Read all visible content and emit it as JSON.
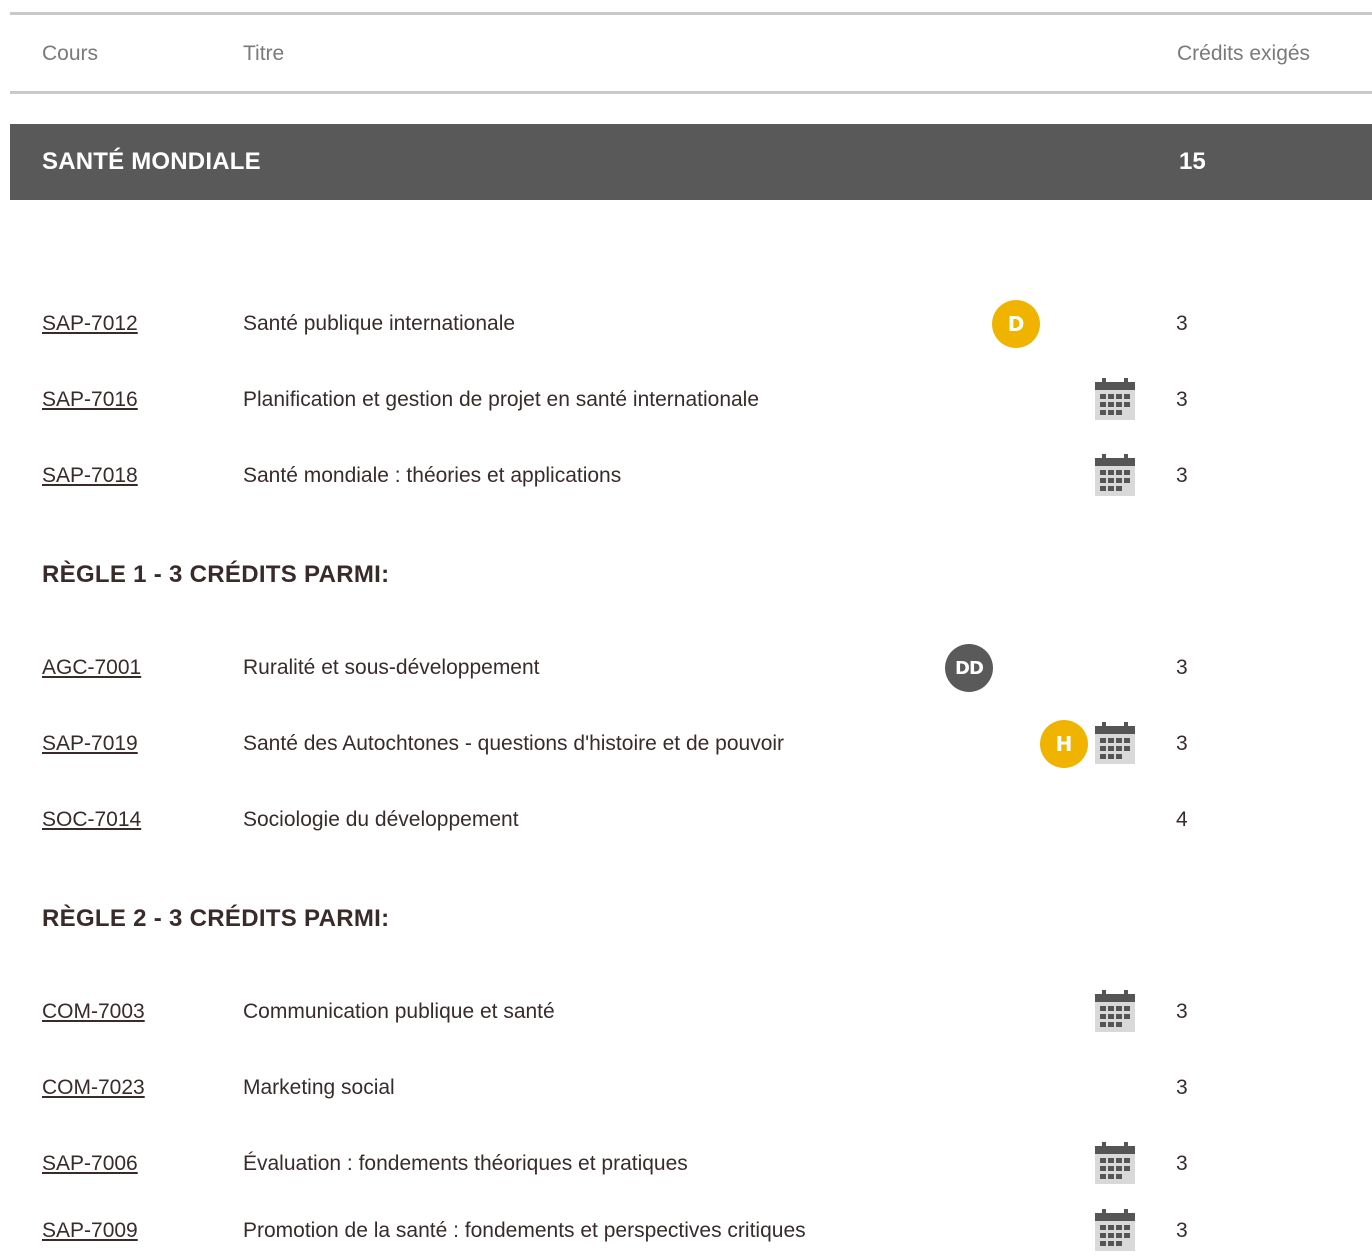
{
  "header": {
    "col_course": "Cours",
    "col_title": "Titre",
    "col_credits": "Crédits exigés"
  },
  "section": {
    "title": "SANTÉ MONDIALE",
    "credits": "15"
  },
  "colors": {
    "section_bar": "#595959",
    "badge_yellow": "#f0b400",
    "badge_grey": "#5a5a5a",
    "text": "#3a2b2b"
  },
  "required_courses": [
    {
      "code": "SAP-7012",
      "title": "Santé publique internationale",
      "credits": "3",
      "badge": "D",
      "calendar": false
    },
    {
      "code": "SAP-7016",
      "title": "Planification et gestion de projet en santé internationale",
      "credits": "3",
      "badge": null,
      "calendar": true
    },
    {
      "code": "SAP-7018",
      "title": "Santé mondiale : théories et applications",
      "credits": "3",
      "badge": null,
      "calendar": true
    }
  ],
  "rule1": {
    "title": "RÈGLE 1 - 3 CRÉDITS PARMI:",
    "courses": [
      {
        "code": "AGC-7001",
        "title": "Ruralité et sous-développement",
        "credits": "3",
        "badge": "DD",
        "calendar": false
      },
      {
        "code": "SAP-7019",
        "title": "Santé des Autochtones - questions d'histoire et de pouvoir",
        "credits": "3",
        "badge": "H",
        "calendar": true
      },
      {
        "code": "SOC-7014",
        "title": "Sociologie du développement",
        "credits": "4",
        "badge": null,
        "calendar": false
      }
    ]
  },
  "rule2": {
    "title": "RÈGLE 2 - 3 CRÉDITS PARMI:",
    "courses": [
      {
        "code": "COM-7003",
        "title": "Communication publique et santé",
        "credits": "3",
        "badge": null,
        "calendar": true
      },
      {
        "code": "COM-7023",
        "title": "Marketing social",
        "credits": "3",
        "badge": null,
        "calendar": false
      },
      {
        "code": "SAP-7006",
        "title": "Évaluation : fondements théoriques et pratiques",
        "credits": "3",
        "badge": null,
        "calendar": true
      },
      {
        "code": "SAP-7009",
        "title": "Promotion de la santé : fondements et perspectives critiques",
        "credits": "3",
        "badge": null,
        "calendar": true
      }
    ]
  }
}
